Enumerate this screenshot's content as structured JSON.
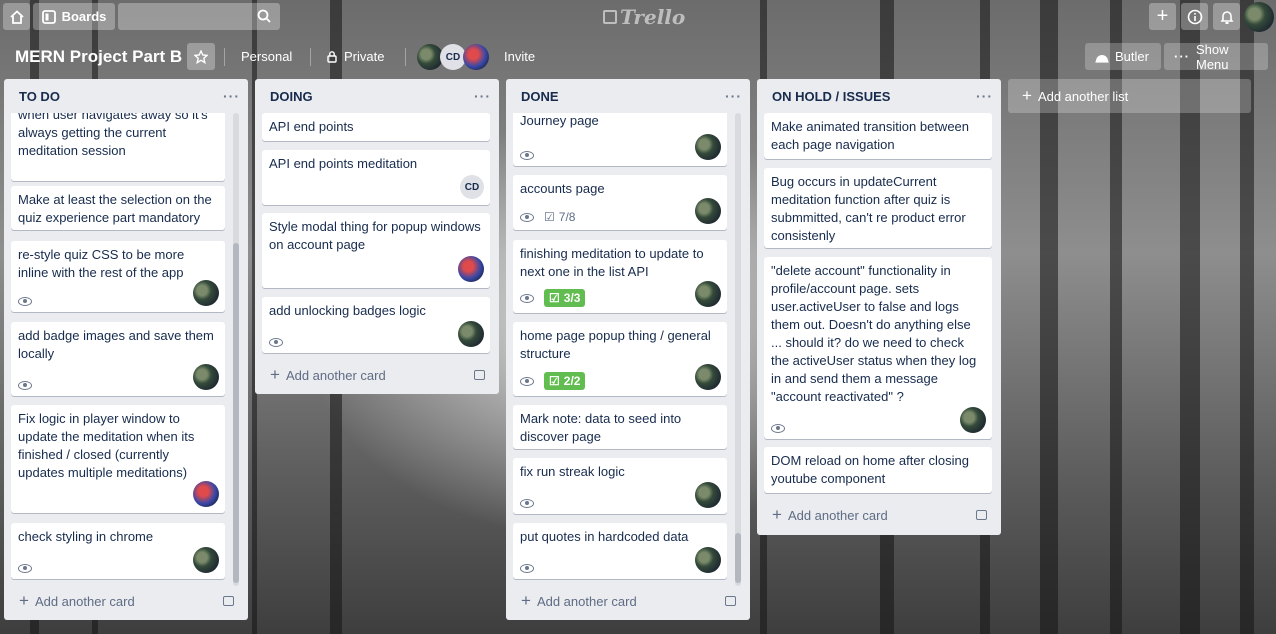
{
  "header": {
    "boards_label": "Boards",
    "search_placeholder": "",
    "logo_text": "Trello"
  },
  "board": {
    "title": "MERN Project Part B",
    "team_label": "Personal",
    "visibility_label": "Private",
    "members": [
      "avatar",
      "CD",
      "avatar"
    ],
    "invite_label": "Invite",
    "butler_label": "Butler",
    "show_menu_label": "Show Menu"
  },
  "lists": [
    {
      "title": "TO DO",
      "add_card_label": "Add another card",
      "cards": [
        {
          "text": "Make home page re-fetch api when user navigates away so it's always getting the current meditation session"
        },
        {
          "text": "Make at least the selection on the quiz experience part mandatory"
        },
        {
          "text": "re-style quiz CSS to be more inline with the rest of the app",
          "watch": true,
          "member": "avatar"
        },
        {
          "text": "add badge images and save them locally",
          "watch": true,
          "member": "avatar"
        },
        {
          "text": "Fix logic in player window to update the meditation when its finished / closed (currently updates multiple meditations)",
          "member": "avatar2"
        },
        {
          "text": "check styling in chrome",
          "watch": true,
          "member": "avatar"
        }
      ]
    },
    {
      "title": "DOING",
      "add_card_label": "Add another card",
      "cards": [
        {
          "text": "API end points"
        },
        {
          "text": "API end points meditation",
          "member": "CD"
        },
        {
          "text": "Style modal thing for popup windows on account page",
          "member": "avatar2"
        },
        {
          "text": "add unlocking badges logic",
          "watch": true,
          "member": "avatar"
        }
      ]
    },
    {
      "title": "DONE",
      "add_card_label": "Add another card",
      "cards": [
        {
          "text": "Journey page",
          "watch": true,
          "member": "avatar"
        },
        {
          "text": "accounts page",
          "watch": true,
          "checklist": "7/8",
          "member": "avatar"
        },
        {
          "text": "finishing meditation to update to next one in the list API",
          "watch": true,
          "checklist": "3/3",
          "complete": true,
          "member": "avatar"
        },
        {
          "text": "home page popup thing / general structure",
          "watch": true,
          "checklist": "2/2",
          "complete": true,
          "member": "avatar"
        },
        {
          "text": "Mark note: data to seed into discover page"
        },
        {
          "text": "fix run streak logic",
          "watch": true,
          "member": "avatar"
        },
        {
          "text": "put quotes in hardcoded data",
          "watch": true,
          "member": "avatar"
        }
      ]
    },
    {
      "title": "ON HOLD / ISSUES",
      "add_card_label": "Add another card",
      "cards": [
        {
          "text": "Make animated transition between each page navigation"
        },
        {
          "text": "Bug occurs in updateCurrent meditation function after quiz is submmitted, can't re product error consistenly"
        },
        {
          "text": "\"delete account\" functionality in profile/account page. sets user.activeUser to false and logs them out. Doesn't do anything else ... should it? do we need to check the activeUser status when they log in and send them a message \"account reactivated\" ?",
          "watch": true,
          "member": "avatar"
        },
        {
          "text": "DOM reload on home after closing youtube component"
        }
      ]
    }
  ],
  "add_list_label": "Add another list",
  "icons": {
    "home": "home-icon",
    "boards": "board-icon",
    "search": "search-icon",
    "create": "plus-icon",
    "info": "info-icon",
    "notifications": "bell-icon",
    "star": "star-icon",
    "lock": "lock-icon",
    "butler": "butler-icon",
    "more": "ellipsis-icon",
    "watch": "eye-icon",
    "checklist": "checklist-icon"
  },
  "colors": {
    "list_bg": "#ebecf0",
    "checklist_complete": "#61bd4f",
    "text": "#172b4d"
  }
}
